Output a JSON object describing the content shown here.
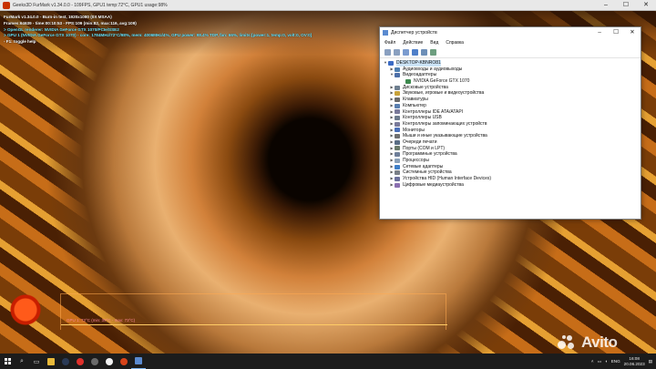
{
  "furmark": {
    "window_title": "Geeks3D FurMark v1.34.0.0 - 109FPS, GPU1 temp:72°C, GPU1 usage:98%",
    "overlay_lines": [
      {
        "text": "FurMark v1.34.0.0 - Burn-in test, 1920x1080 (0X MSAA)",
        "style": "white"
      },
      {
        "text": "Frames:64639 - time:00:10:53 - FPS:109 (min:82, max:116, avg:109)",
        "style": "white"
      },
      {
        "text": "> OpenGL renderer: NVIDIA GeForce GTX 1070/PCIe/SSE2",
        "style": "cyan"
      },
      {
        "text": "> GPU 1 (NVIDIA GeForce GTX 1070) - core: 1784MHz/72°C/98%, mem: 4006MHz/4%, GPU power: 98.4% TDP, fan: 66%, limits:[power:1, temp:0, volt:0, OV:0]",
        "style": "cyan"
      },
      {
        "text": "- F1: toggle help",
        "style": "white"
      }
    ],
    "graph_label": "GPU 1: 72°C (min: 39°C - max: 73°C)"
  },
  "device_manager": {
    "title": "Диспетчер устройств",
    "menu": [
      "Файл",
      "Действие",
      "Вид",
      "Справка"
    ],
    "root": "DESKTOP-KBNRO81",
    "nodes": [
      {
        "label": "Аудиовходы и аудиовыходы",
        "level": 1,
        "expanded": false
      },
      {
        "label": "Видеоадаптеры",
        "level": 1,
        "expanded": true
      },
      {
        "label": "NVIDIA GeForce GTX 1070",
        "level": 2,
        "expanded": null
      },
      {
        "label": "Дисковые устройства",
        "level": 1,
        "expanded": false
      },
      {
        "label": "Звуковые, игровые и видеоустройства",
        "level": 1,
        "expanded": false
      },
      {
        "label": "Клавиатуры",
        "level": 1,
        "expanded": false
      },
      {
        "label": "Компьютер",
        "level": 1,
        "expanded": false
      },
      {
        "label": "Контроллеры IDE ATA/ATAPI",
        "level": 1,
        "expanded": false
      },
      {
        "label": "Контроллеры USB",
        "level": 1,
        "expanded": false
      },
      {
        "label": "Контроллеры запоминающих устройств",
        "level": 1,
        "expanded": false
      },
      {
        "label": "Мониторы",
        "level": 1,
        "expanded": false
      },
      {
        "label": "Мыши и иные указывающие устройства",
        "level": 1,
        "expanded": false
      },
      {
        "label": "Очереди печати",
        "level": 1,
        "expanded": false
      },
      {
        "label": "Порты (COM и LPT)",
        "level": 1,
        "expanded": false
      },
      {
        "label": "Программные устройства",
        "level": 1,
        "expanded": false
      },
      {
        "label": "Процессоры",
        "level": 1,
        "expanded": false
      },
      {
        "label": "Сетевые адаптеры",
        "level": 1,
        "expanded": false
      },
      {
        "label": "Системные устройства",
        "level": 1,
        "expanded": false
      },
      {
        "label": "Устройства HID (Human Interface Devices)",
        "level": 1,
        "expanded": false
      },
      {
        "label": "Цифровые медиаустройства",
        "level": 1,
        "expanded": false
      }
    ]
  },
  "taskbar": {
    "language": "ENG",
    "time": "16:08",
    "date": "20.06.2023"
  },
  "watermark": "Avito",
  "colors": {
    "accent": "#cce4f7",
    "overlay_cyan": "#69e6ff",
    "taskbar": "#1c1c1c"
  }
}
